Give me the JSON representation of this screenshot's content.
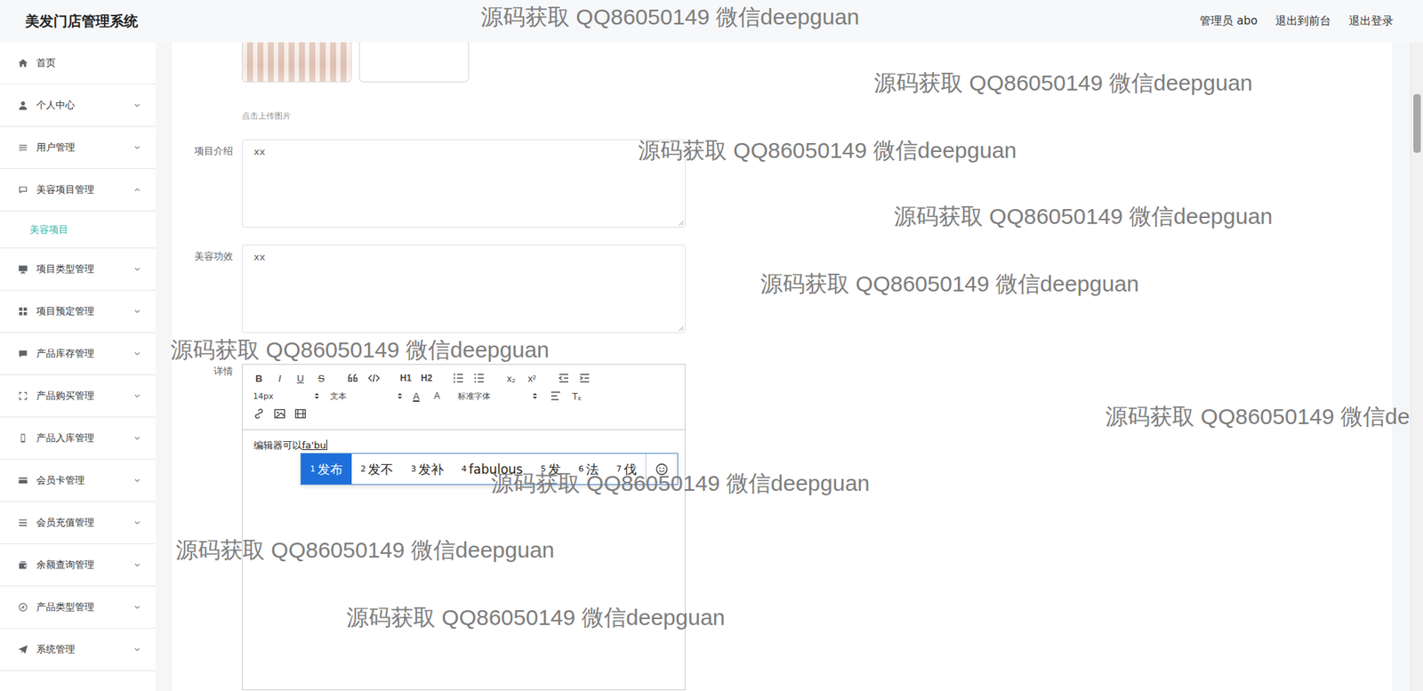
{
  "header": {
    "title": "美发门店管理系统",
    "user": "管理员 abo",
    "links": [
      "退出到前台",
      "退出登录"
    ]
  },
  "sidebar": {
    "items": [
      {
        "label": "首页",
        "kind": "link",
        "expanded": false,
        "selected": false,
        "children": []
      },
      {
        "label": "个人中心",
        "kind": "group",
        "expanded": false,
        "selected": false,
        "children": []
      },
      {
        "label": "用户管理",
        "kind": "group",
        "expanded": false,
        "selected": false,
        "children": []
      },
      {
        "label": "美容项目管理",
        "kind": "group",
        "expanded": true,
        "selected": false,
        "children": [
          {
            "label": "美容项目",
            "selected": true
          }
        ]
      },
      {
        "label": "项目类型管理",
        "kind": "group",
        "expanded": false,
        "selected": false,
        "children": []
      },
      {
        "label": "项目预定管理",
        "kind": "group",
        "expanded": false,
        "selected": false,
        "children": []
      },
      {
        "label": "产品库存管理",
        "kind": "group",
        "expanded": false,
        "selected": false,
        "children": []
      },
      {
        "label": "产品购买管理",
        "kind": "group",
        "expanded": false,
        "selected": false,
        "children": []
      },
      {
        "label": "产品入库管理",
        "kind": "group",
        "expanded": false,
        "selected": false,
        "children": []
      },
      {
        "label": "会员卡管理",
        "kind": "group",
        "expanded": false,
        "selected": false,
        "children": []
      },
      {
        "label": "会员充值管理",
        "kind": "group",
        "expanded": false,
        "selected": false,
        "children": []
      },
      {
        "label": "余额查询管理",
        "kind": "group",
        "expanded": false,
        "selected": false,
        "children": []
      },
      {
        "label": "产品类型管理",
        "kind": "group",
        "expanded": false,
        "selected": false,
        "children": []
      },
      {
        "label": "系统管理",
        "kind": "group",
        "expanded": false,
        "selected": false,
        "children": []
      }
    ]
  },
  "form": {
    "upload": {
      "images": [
        {
          "kind": "photo"
        },
        {
          "kind": "empty"
        }
      ],
      "hint": "点击上传图片"
    },
    "fields": [
      {
        "label": "项目介绍",
        "value": "xx"
      },
      {
        "label": "美容功效",
        "value": "xx"
      }
    ],
    "editor": {
      "label": "详情",
      "toolbar": {
        "bold": "B",
        "italic": "I",
        "underline": "U",
        "strike": "S",
        "h1": "H1",
        "h2": "H2",
        "sub": "x₂",
        "sup": "x²",
        "size": "14px",
        "header": "文本",
        "color": "A",
        "background": "A",
        "font": "标准字体",
        "clean": "Tₓ"
      },
      "content": "编辑器可以",
      "composition": "fa'bu"
    }
  },
  "ime": {
    "candidates": [
      {
        "index": "1",
        "text": "发布",
        "selected": true
      },
      {
        "index": "2",
        "text": "发不",
        "selected": false
      },
      {
        "index": "3",
        "text": "发补",
        "selected": false
      },
      {
        "index": "4",
        "text": "fabulous",
        "selected": false
      },
      {
        "index": "5",
        "text": "发",
        "selected": false
      },
      {
        "index": "6",
        "text": "法",
        "selected": false
      },
      {
        "index": "7",
        "text": "伐",
        "selected": false
      }
    ]
  },
  "scrollbar": {
    "offset": 0.08,
    "size": 0.09
  },
  "watermarks": [
    "源码获取 QQ86050149 微信deepguan",
    "源码获取 QQ86050149 微信deepguan",
    "源码获取 QQ86050149 微信deepguan",
    "源码获取 QQ86050149 微信deepguan",
    "源码获取 QQ86050149 微信deepguan",
    "源码获取 QQ86050149 微信deepguan",
    "源码获取 QQ86050149 微信de",
    "源码获取 QQ86050149 微信deepguan",
    "源码获取 QQ86050149 微信deepguan",
    "源码获取 QQ86050149 微信deepguan"
  ]
}
